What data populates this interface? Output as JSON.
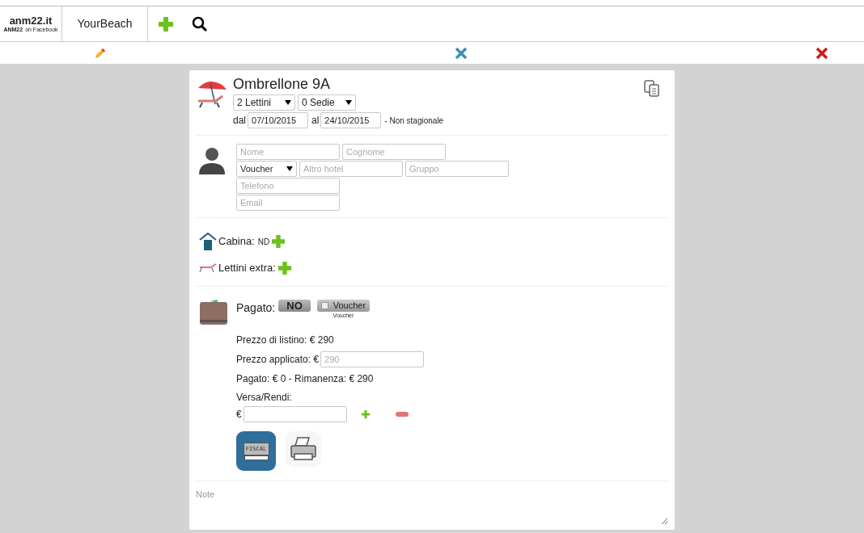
{
  "header": {
    "logo": {
      "title": "anm22.it",
      "sub": "ANM22",
      "fb": "on Facebook"
    },
    "app_name": "YourBeach"
  },
  "booking": {
    "title": "Ombrellone 9A",
    "selects": [
      {
        "value": "2 Lettini"
      },
      {
        "value": "0 Sedie"
      }
    ],
    "from_label": "dal",
    "from": "07/10/2015",
    "to_label": "al",
    "to": "24/10/2015",
    "season": "- Non stagionale"
  },
  "customer": {
    "fields": [
      {
        "placeholder": "Nome"
      },
      {
        "placeholder": "Cognome"
      },
      {
        "kind": "select",
        "value": "Voucher"
      },
      {
        "placeholder": "Altro hotel"
      },
      {
        "placeholder": "Gruppo"
      },
      {
        "placeholder": "Telefono"
      },
      {
        "placeholder": "Email"
      }
    ]
  },
  "extras": [
    {
      "kind": "cabin",
      "label": "Cabina:",
      "value": "ND"
    },
    {
      "kind": "loungers",
      "label": "Lettini extra:"
    }
  ],
  "payment": {
    "label": "Pagato:",
    "paid_button": "NO",
    "voucher": {
      "label": "Voucher",
      "checked": false,
      "caption": "Voucher"
    },
    "list_price": "Prezzo di listino: € 290",
    "applied_label": "Prezzo applicato: €",
    "applied_placeholder": "290",
    "summary": "Pagato: € 0 - Rimanenza: € 290",
    "versa_label": "Versa/Rendi:",
    "euro": "€",
    "fiscal": "FISCAL"
  },
  "notes": {
    "placeholder": "Note"
  }
}
